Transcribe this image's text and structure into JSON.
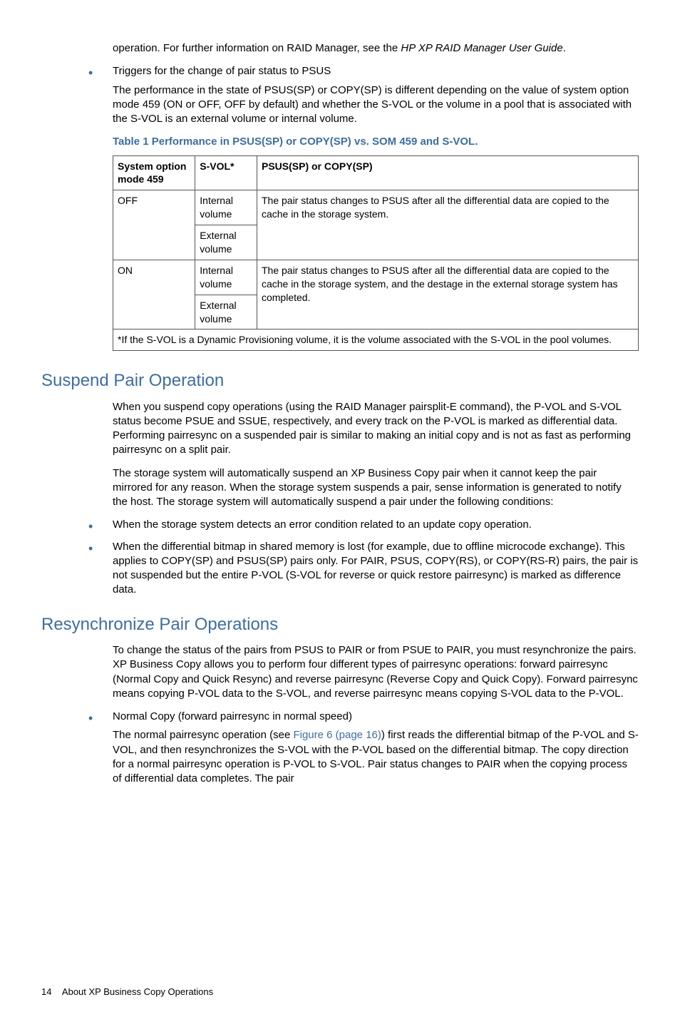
{
  "intro": {
    "p1_a": "operation. For further information on RAID Manager, see the ",
    "p1_i": "HP XP RAID Manager User Guide",
    "p1_b": "."
  },
  "triggers": {
    "li_title": "Triggers for the change of pair status to PSUS",
    "li_body": "The performance in the state of PSUS(SP) or COPY(SP) is different depending on the value of system option mode 459 (ON or OFF, OFF by default) and whether the S-VOL or the volume in a pool that is associated with the S-VOL is an external volume or internal volume."
  },
  "table": {
    "caption": "Table 1 Performance in PSUS(SP) or COPY(SP) vs. SOM 459 and S-VOL.",
    "headers": [
      "System option mode 459",
      "S-VOL*",
      "PSUS(SP) or COPY(SP)"
    ],
    "rows": [
      {
        "c1": "OFF",
        "c2": "Internal volume",
        "c3": "The pair status changes to PSUS after all the differential data are copied to the cache in the storage system."
      },
      {
        "c1": "",
        "c2": "External volume",
        "c3": ""
      },
      {
        "c1": "ON",
        "c2": "Internal volume",
        "c3": "The pair status changes to PSUS after all the differential data are copied to the cache in the storage system, and the destage in the external storage system has completed."
      },
      {
        "c1": "",
        "c2": "External volume",
        "c3": ""
      }
    ],
    "footnote": "*If the S-VOL is a Dynamic Provisioning volume, it is the volume associated with the S-VOL in the pool volumes."
  },
  "suspend": {
    "heading": "Suspend Pair Operation",
    "p1": "When you suspend copy operations (using the RAID Manager pairsplit-E command), the P-VOL and S-VOL status become PSUE and SSUE, respectively, and every track on the P-VOL is marked as differential data. Performing pairresync on a suspended pair is similar to making an initial copy and is not as fast as performing pairresync on a split pair.",
    "p2": "The storage system will automatically suspend an XP Business Copy pair when it cannot keep the pair mirrored for any reason. When the storage system suspends a pair, sense information is generated to notify the host. The storage system will automatically suspend a pair under the following conditions:",
    "li1": "When the storage system detects an error condition related to an update copy operation.",
    "li2": "When the differential bitmap in shared memory is lost (for example, due to offline microcode exchange). This applies to COPY(SP) and PSUS(SP) pairs only. For PAIR, PSUS, COPY(RS), or COPY(RS-R) pairs, the pair is not suspended but the entire P-VOL (S-VOL for reverse or quick restore pairresync) is marked as difference data."
  },
  "resync": {
    "heading": "Resynchronize Pair Operations",
    "p1": "To change the status of the pairs from PSUS to PAIR or from PSUE to PAIR, you must resynchronize the pairs. XP Business Copy allows you to perform four different types of pairresync operations: forward pairresync (Normal Copy and Quick Resync) and reverse pairresync (Reverse Copy and Quick Copy). Forward pairresync means copying P-VOL data to the S-VOL, and reverse pairresync means copying S-VOL data to the P-VOL.",
    "li1_title": "Normal Copy (forward pairresync in normal speed)",
    "li1_body_a": "The normal pairresync operation (see ",
    "li1_body_link": "Figure 6 (page 16)",
    "li1_body_b": ") first reads the differential bitmap of the P-VOL and S-VOL, and then resynchronizes the S-VOL with the P-VOL based on the differential bitmap. The copy direction for a normal pairresync operation is P-VOL to S-VOL. Pair status changes to PAIR when the copying process of differential data completes. The pair"
  },
  "footer": {
    "page": "14",
    "title": "About XP Business Copy Operations"
  }
}
